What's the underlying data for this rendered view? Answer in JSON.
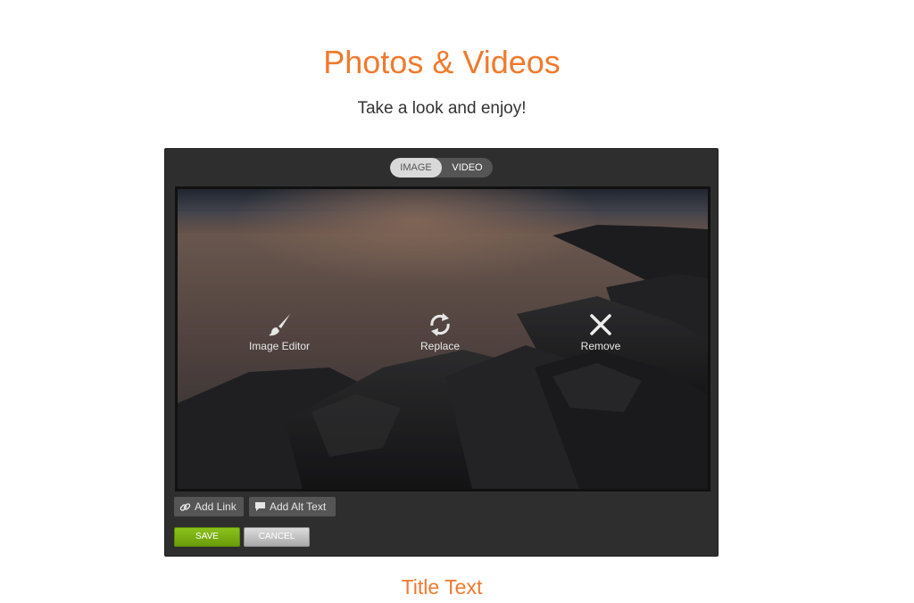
{
  "header": {
    "title": "Photos & Videos",
    "subtitle": "Take a look and enjoy!"
  },
  "editor": {
    "toggle": {
      "image_label": "IMAGE",
      "video_label": "VIDEO",
      "selected": "IMAGE"
    },
    "actions": {
      "editor_label": "Image Editor",
      "replace_label": "Replace",
      "remove_label": "Remove"
    },
    "tools": {
      "add_link_label": "Add Link",
      "add_alt_text_label": "Add Alt Text"
    },
    "buttons": {
      "save_label": "SAVE",
      "cancel_label": "CANCEL"
    }
  },
  "caption": {
    "title": "Title Text"
  },
  "colors": {
    "accent": "#f07a2e",
    "panel": "#2e2e2e",
    "save": "#7cb213",
    "cancel": "#c4c4c4"
  },
  "icons": [
    "brush-icon",
    "refresh-icon",
    "close-icon",
    "link-icon",
    "comment-icon"
  ]
}
